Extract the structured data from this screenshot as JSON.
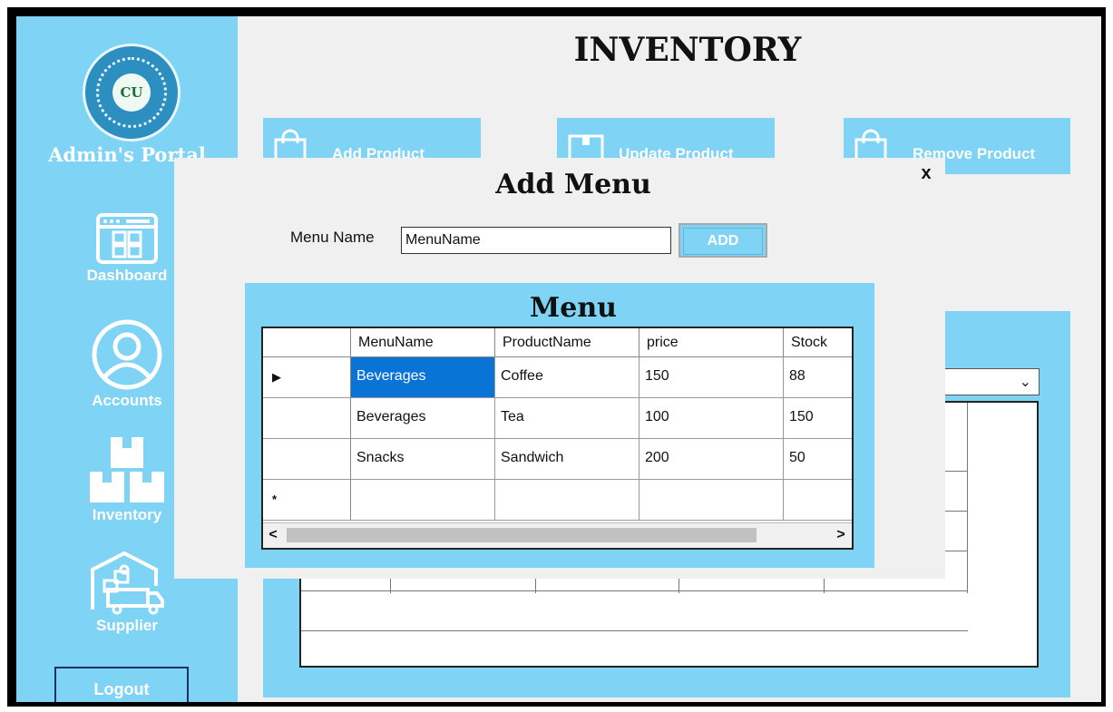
{
  "sidebar": {
    "portal_title": "Admin's Portal",
    "logo_text": "CU",
    "items": [
      {
        "label": "Dashboard",
        "icon": "dashboard-icon"
      },
      {
        "label": "Accounts",
        "icon": "account-icon"
      },
      {
        "label": "Inventory",
        "icon": "boxes-icon"
      },
      {
        "label": "Supplier",
        "icon": "warehouse-truck-icon"
      }
    ],
    "logout_label": "Logout"
  },
  "main": {
    "title": "INVENTORY",
    "buttons": [
      {
        "label": "Add Product",
        "icon": "shopping-bag-icon"
      },
      {
        "label": "Update Product",
        "icon": "box-icon"
      },
      {
        "label": "Remove Product",
        "icon": "shopping-bag-icon"
      }
    ],
    "new_row_marker": "*"
  },
  "dialog": {
    "title": "Add Menu",
    "close_label": "x",
    "menu_name_label": "Menu Name",
    "menu_name_value": "MenuName",
    "add_button_label": "ADD",
    "panel_title": "Menu",
    "columns": [
      "MenuName",
      "ProductName",
      "price",
      "Stock"
    ],
    "rows": [
      {
        "marker": "▶",
        "MenuName": "Beverages",
        "ProductName": "Coffee",
        "price": "150",
        "Stock": "88"
      },
      {
        "marker": "",
        "MenuName": "Beverages",
        "ProductName": "Tea",
        "price": "100",
        "Stock": "150"
      },
      {
        "marker": "",
        "MenuName": "Snacks",
        "ProductName": "Sandwich",
        "price": "200",
        "Stock": "50"
      },
      {
        "marker": "*",
        "MenuName": "",
        "ProductName": "",
        "price": "",
        "Stock": ""
      }
    ],
    "scroll_left": "<",
    "scroll_right": ">"
  },
  "colors": {
    "sidebar": "#7fd3f5",
    "selected_cell": "#0a74d6",
    "window_bg": "#f0f0f0"
  }
}
